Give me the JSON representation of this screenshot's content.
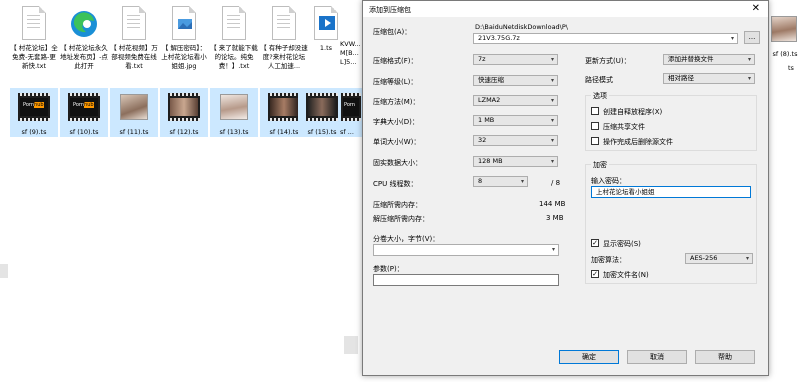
{
  "desktop": {
    "row1": [
      {
        "label": "【 村花论坛】全免费-无套路-更新快.txt"
      },
      {
        "label": "【 村花论坛永久地址发布页】-点此打开"
      },
      {
        "label": "【 村花视频】万部视频免费在线看.txt"
      },
      {
        "label": "【 解压密码】：上村花论坛看小姐姐.jpg"
      },
      {
        "label": "【 来了就能下载的论坛。纯免费！】.txt"
      },
      {
        "label": "【 有种子却没速度?来村花论坛人工加速..."
      },
      {
        "label": "1.ts"
      },
      {
        "label": "KVW... M[B... L]5..."
      }
    ],
    "row2": [
      {
        "label": "sf (9).ts"
      },
      {
        "label": "sf (10).ts"
      },
      {
        "label": "sf (11).ts"
      },
      {
        "label": "sf (12).ts"
      },
      {
        "label": "sf (13).ts"
      },
      {
        "label": "sf (14).ts"
      },
      {
        "label": "sf (15).ts"
      },
      {
        "label": "sf ..."
      }
    ],
    "right_file": {
      "label": "sf (8).ts"
    },
    "right_label2": "ts"
  },
  "dialog": {
    "title": "添加到压缩包",
    "close_glyph": "✕",
    "archive_label": "压缩包(A)：",
    "archive_path": "D:\\BaiduNetdiskDownload\\P\\",
    "archive_name": "21V3.75G.7z",
    "browse_label": "...",
    "format_label": "压缩格式(F)：",
    "format_value": "7z",
    "level_label": "压缩等级(L)：",
    "level_value": "快速压缩",
    "method_label": "压缩方法(M)：",
    "method_value": "LZMA2",
    "dict_label": "字典大小(D)：",
    "dict_value": "1 MB",
    "word_label": "单词大小(W)：",
    "word_value": "32",
    "solid_label": "固实数据大小：",
    "solid_value": "128 MB",
    "threads_label": "CPU 线程数：",
    "threads_value": "8",
    "threads_total": "/ 8",
    "mem_comp_label": "压缩所需内存：",
    "mem_comp_value": "144 MB",
    "mem_decomp_label": "解压缩所需内存：",
    "mem_decomp_value": "3 MB",
    "split_label": "分卷大小，字节(V)：",
    "split_value": "",
    "params_label": "参数(P)：",
    "params_value": "",
    "update_label": "更新方式(U)：",
    "update_value": "添加并替换文件",
    "pathmode_label": "路径模式",
    "pathmode_value": "相对路径",
    "options_title": "选项",
    "opt_sfx": "创建自释放程序(X)",
    "opt_shared": "压缩共享文件",
    "opt_delete": "操作完成后删除源文件",
    "encrypt_title": "加密",
    "password_label": "输入密码：",
    "password_value": "上村花论坛看小姐姐",
    "show_password": "显示密码(S)",
    "enc_method_label": "加密算法：",
    "enc_method_value": "AES-256",
    "encrypt_names": "加密文件名(N)",
    "check_glyph": "✓",
    "ok": "确定",
    "cancel": "取消",
    "help": "帮助",
    "arrow": "▾"
  }
}
